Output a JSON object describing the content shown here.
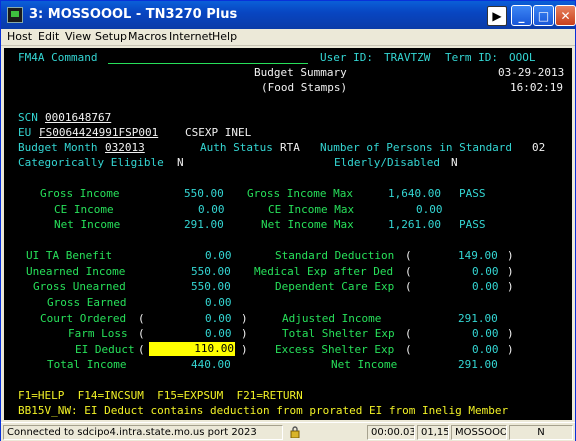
{
  "window": {
    "title": "3: MOSSOOOL - TN3270 Plus",
    "play_glyph": "▶",
    "min_glyph": "_",
    "max_glyph": "□",
    "close_glyph": "✕"
  },
  "menu": [
    {
      "label": "Host"
    },
    {
      "label": "Edit"
    },
    {
      "label": "View"
    },
    {
      "label": "Setup"
    },
    {
      "label": "Macros"
    },
    {
      "label": "Internet"
    },
    {
      "label": "Help"
    }
  ],
  "screen": {
    "command_label": "FM4A Command",
    "user_label": "User ID:",
    "user_id": "TRAVTZW",
    "term_label": "Term ID:",
    "term_id": "OOOL",
    "heading1": "Budget Summary",
    "heading2": "(Food Stamps)",
    "date": "03-29-2013",
    "time": "16:02:19",
    "scn_label": "SCN",
    "scn": "0001648767",
    "eu_label": "EU",
    "eu": "FS0064424991FSP001",
    "eu_extra": "CSEXP INEL",
    "budget_month_label": "Budget Month",
    "budget_month": "032013",
    "auth_status_label": "Auth Status",
    "auth_status": "RTA",
    "persons_label": "Number of Persons in Standard",
    "persons": "02",
    "cat_elig_label": "Categorically Eligible",
    "cat_elig": "N",
    "elderly_label": "Elderly/Disabled",
    "elderly": "N",
    "income_rows": [
      {
        "label": "Gross Income",
        "value": "550.00",
        "max_label": "Gross Income Max",
        "max_value": "1,640.00",
        "result": "PASS"
      },
      {
        "label": "CE Income",
        "value": "0.00",
        "max_label": "CE Income Max",
        "max_value": "0.00",
        "result": ""
      },
      {
        "label": "Net Income",
        "value": "291.00",
        "max_label": "Net Income Max",
        "max_value": "1,261.00",
        "result": "PASS"
      }
    ],
    "left_rows": [
      {
        "label": "UI TA Benefit",
        "value": "0.00"
      },
      {
        "label": "Unearned Income",
        "value": "550.00"
      },
      {
        "label": "Gross Unearned",
        "value": "550.00"
      },
      {
        "label": "Gross Earned",
        "value": "0.00"
      },
      {
        "label": "Court Ordered",
        "value": "0.00"
      },
      {
        "label": "Farm Loss",
        "value": "0.00"
      },
      {
        "label": "EI Deduct",
        "value": "110.00"
      },
      {
        "label": "Total Income",
        "value": "440.00"
      }
    ],
    "right_rows": [
      {
        "label": "Standard Deduction",
        "value": "149.00"
      },
      {
        "label": "Medical Exp after Ded",
        "value": "0.00"
      },
      {
        "label": "Dependent Care Exp",
        "value": "0.00"
      },
      {
        "label": "Adjusted Income",
        "value": "291.00"
      },
      {
        "label": "Total Shelter Exp",
        "value": "0.00"
      },
      {
        "label": "Excess Shelter Exp",
        "value": "0.00"
      },
      {
        "label": "Net Income",
        "value": "291.00"
      }
    ],
    "paren_open": "(",
    "paren_close": ")",
    "fkeys": "F1=HELP  F14=INCSUM  F15=EXPSUM  F21=RETURN",
    "message": "BB15V_NW: EI Deduct contains deduction from prorated EI from Inelig Member"
  },
  "status": {
    "connection": "Connected to sdcipo4.intra.state.mo.us port 2023",
    "timer": "00:00.031",
    "cursor_pos": "01,15",
    "session": "MOSSOOOL",
    "mode": "N"
  }
}
